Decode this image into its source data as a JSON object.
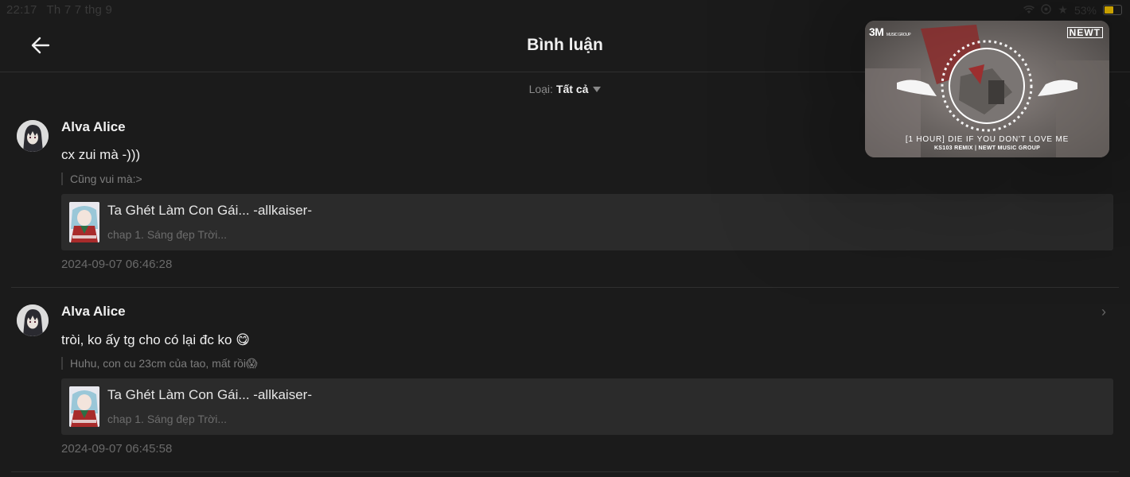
{
  "status_bar": {
    "time": "22:17",
    "date": "Th 7 7 thg 9",
    "battery": "53%",
    "battery_level": 0.53,
    "battery_color": "#f2c200"
  },
  "header": {
    "title": "Bình luận",
    "back_icon": "arrow-left-icon"
  },
  "filter": {
    "label": "Loại:",
    "value": "Tất cả"
  },
  "comments": [
    {
      "username": "Alva Alice",
      "text": "cx zui mà -)))",
      "quote": "Cũng vui mà:>",
      "story_title": "Ta Ghét Làm Con Gái... -allkaiser-",
      "story_chapter": "chap 1. Sáng đẹp Trời...",
      "timestamp": "2024-09-07 06:46:28"
    },
    {
      "username": "Alva Alice",
      "text": "tròi, ko ấy tg cho có lại đc ko 😋",
      "quote": "Huhu, con cu 23cm của tao, mất rồi😱",
      "story_title": "Ta Ghét Làm Con Gái... -allkaiser-",
      "story_chapter": "chap 1. Sáng đẹp Trời...",
      "timestamp": "2024-09-07 06:45:58"
    }
  ],
  "media_overlay": {
    "brand_left": "3M",
    "brand_left_small": "MUSIC GROUP",
    "brand_right": "NEWT",
    "song_title": "[1 HOUR] DIE IF YOU DON'T LOVE ME",
    "song_subtitle": "KS103 REMIX | NEWT MUSIC GROUP"
  }
}
